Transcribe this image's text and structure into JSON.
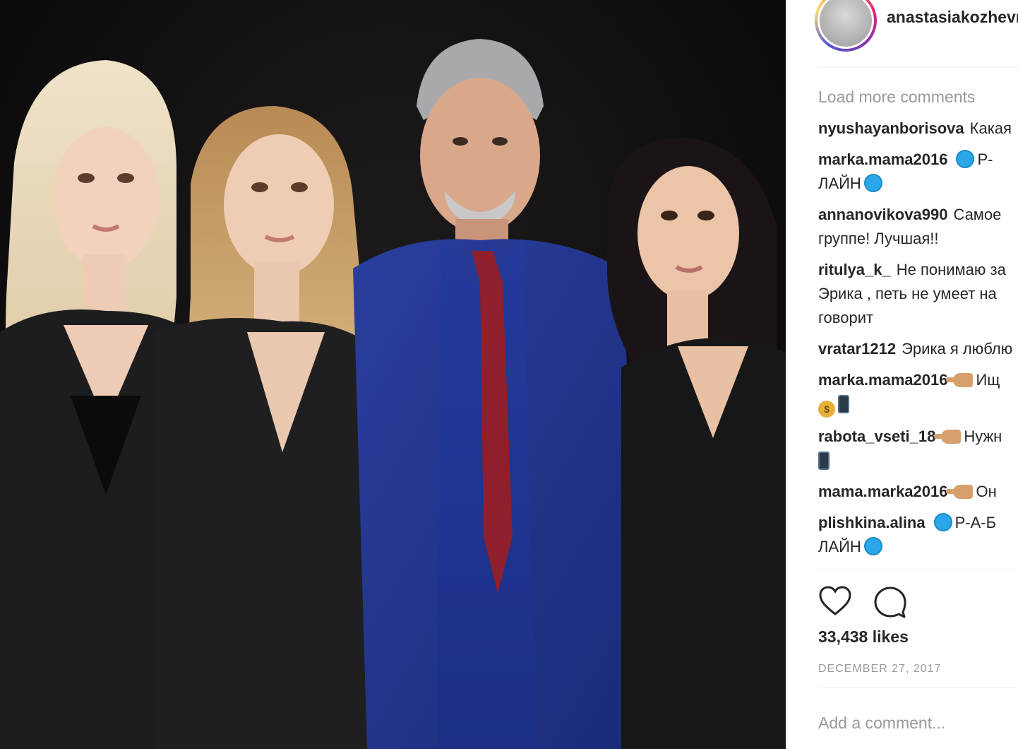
{
  "post": {
    "username": "anastasiakozhevnikova",
    "load_more": "Load more comments",
    "comments": [
      {
        "user": "nyushayanborisova",
        "text": "Какая"
      },
      {
        "user": "marka.mama2016",
        "text": "Р-",
        "line2": "ЛАЙН"
      },
      {
        "user": "annanovikova990",
        "text": "Самое",
        "line2": "группе! Лучшая!!"
      },
      {
        "user": "ritulya_k_",
        "text": "Не понимаю за",
        "line2": "Эрика , петь не умеет на",
        "line3": "говорит"
      },
      {
        "user": "vratar1212",
        "text": "Эрика я люблю"
      },
      {
        "user": "marka.mama2016",
        "text": "Ищ"
      },
      {
        "user": "rabota_vseti_18",
        "text": "Нужн"
      },
      {
        "user": "mama.marka2016",
        "text": "Он"
      },
      {
        "user": "plishkina.alina",
        "text": "Р-А-Б",
        "line2": "ЛАЙН"
      }
    ],
    "likes": "33,438 likes",
    "date": "DECEMBER 27, 2017",
    "add_comment_placeholder": "Add a comment..."
  },
  "icons": {
    "like": "heart-icon",
    "comment": "comment-bubble-icon",
    "verified_dot": "blue-circle-emoji",
    "pointing_hand": "pointing-hand-emoji",
    "money_bag": "money-bag-emoji",
    "phone": "mobile-phone-emoji"
  },
  "colors": {
    "text": "#262626",
    "muted": "#999999",
    "divider": "#efefef",
    "photo_background": "#0f0d0e"
  }
}
